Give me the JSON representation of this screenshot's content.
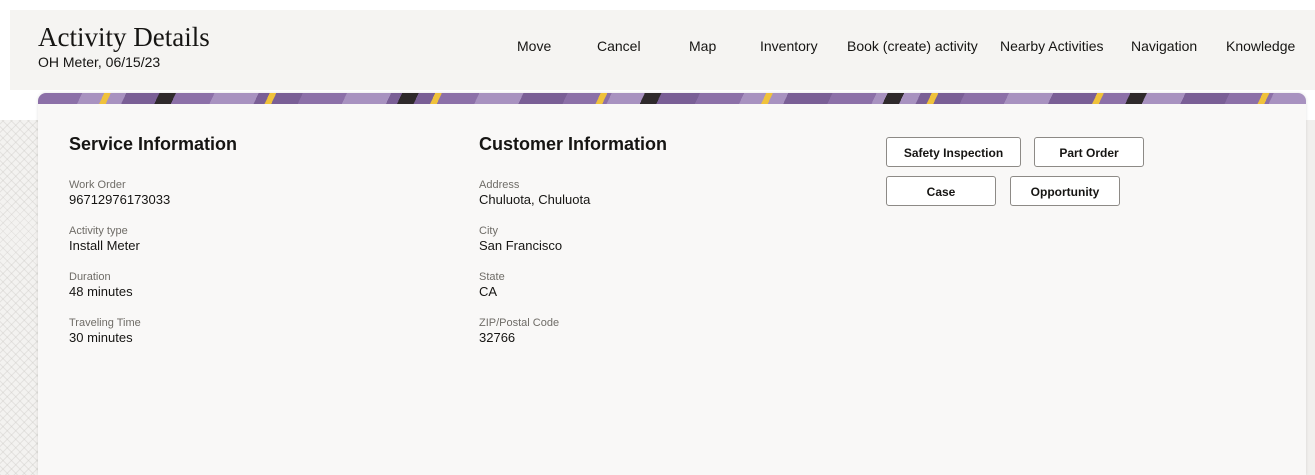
{
  "header": {
    "title": "Activity Details",
    "subtitle": "OH Meter, 06/15/23"
  },
  "nav": {
    "items": [
      "Move",
      "Cancel",
      "Map",
      "Inventory",
      "Book (create) activity",
      "Nearby Activities",
      "Navigation",
      "Knowledge"
    ]
  },
  "service": {
    "title": "Service Information",
    "fields": [
      {
        "label": "Work Order",
        "value": "96712976173033"
      },
      {
        "label": "Activity type",
        "value": "Install Meter"
      },
      {
        "label": "Duration",
        "value": "48 minutes"
      },
      {
        "label": "Traveling Time",
        "value": "30 minutes"
      }
    ]
  },
  "customer": {
    "title": "Customer Information",
    "fields": [
      {
        "label": "Address",
        "value": "Chuluota, Chuluota"
      },
      {
        "label": "City",
        "value": "San Francisco"
      },
      {
        "label": "State",
        "value": "CA"
      },
      {
        "label": "ZIP/Postal Code",
        "value": "32766"
      }
    ]
  },
  "actions": {
    "safety_inspection": "Safety Inspection",
    "part_order": "Part Order",
    "case": "Case",
    "opportunity": "Opportunity"
  }
}
